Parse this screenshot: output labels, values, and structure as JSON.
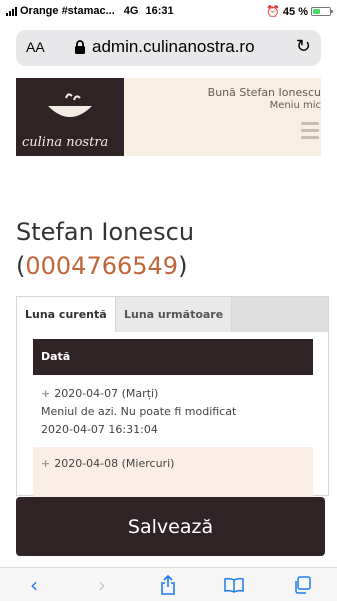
{
  "status_bar": {
    "carrier": "Orange #stamac...",
    "network": "4G",
    "time": "16:31",
    "battery": "45 %",
    "battery_level": 0.45
  },
  "browser": {
    "aa_label": "AA",
    "url": "admin.culinanostra.ro"
  },
  "site": {
    "logo_text": "culina nostra",
    "greeting": "Bună Stefan Ionescu",
    "menu_label": "Meniu mic"
  },
  "user": {
    "name": "Stefan Ionescu",
    "id_open": "(",
    "id": "0004766549",
    "id_close": ")"
  },
  "tabs": [
    {
      "label": "Luna curentă",
      "active": true
    },
    {
      "label": "Luna următoare",
      "active": false
    }
  ],
  "table": {
    "header": "Dată",
    "rows": [
      {
        "date": "2020-04-07 (Marți)",
        "note": "Meniul de azi. Nu poate fi modificat",
        "timestamp": "2020-04-07 16:31:04"
      },
      {
        "date": "2020-04-08 (Miercuri)"
      }
    ]
  },
  "actions": {
    "save_label": "Salvează"
  },
  "colors": {
    "brand_dark": "#2f2326",
    "accent": "#c0673a",
    "link_blue": "#1e7cf2"
  }
}
